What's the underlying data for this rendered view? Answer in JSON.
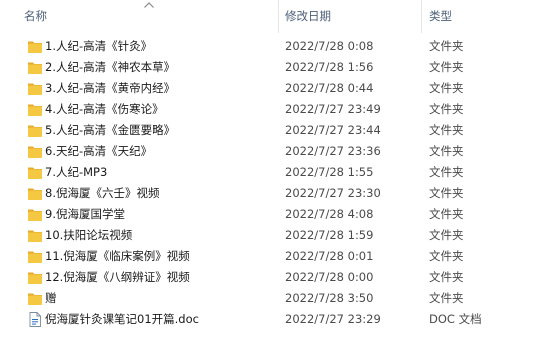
{
  "columns": {
    "name": "名称",
    "date": "修改日期",
    "type": "类型"
  },
  "sort": {
    "column": "name",
    "direction": "ascending",
    "icon": "chevron-up-icon"
  },
  "files": [
    {
      "name": "1.人纪-高清《针灸》",
      "date": "2022/7/28 0:08",
      "type": "文件夹",
      "icon": "folder-icon"
    },
    {
      "name": "2.人纪-高清《神农本草》",
      "date": "2022/7/28 1:56",
      "type": "文件夹",
      "icon": "folder-icon"
    },
    {
      "name": "3.人纪-高清《黄帝内经》",
      "date": "2022/7/28 0:44",
      "type": "文件夹",
      "icon": "folder-icon"
    },
    {
      "name": "4.人纪-高清《伤寒论》",
      "date": "2022/7/27 23:49",
      "type": "文件夹",
      "icon": "folder-icon"
    },
    {
      "name": "5.人纪-高清《金匮要略》",
      "date": "2022/7/27 23:44",
      "type": "文件夹",
      "icon": "folder-icon"
    },
    {
      "name": "6.天纪-高清《天纪》",
      "date": "2022/7/27 23:36",
      "type": "文件夹",
      "icon": "folder-icon"
    },
    {
      "name": "7.人纪-MP3",
      "date": "2022/7/28 1:55",
      "type": "文件夹",
      "icon": "folder-icon"
    },
    {
      "name": "8.倪海厦《六壬》视频",
      "date": "2022/7/27 23:30",
      "type": "文件夹",
      "icon": "folder-icon"
    },
    {
      "name": "9.倪海厦国学堂",
      "date": "2022/7/28 4:08",
      "type": "文件夹",
      "icon": "folder-icon"
    },
    {
      "name": "10.扶阳论坛视频",
      "date": "2022/7/28 1:59",
      "type": "文件夹",
      "icon": "folder-icon"
    },
    {
      "name": "11.倪海厦《临床案例》视频",
      "date": "2022/7/28 0:01",
      "type": "文件夹",
      "icon": "folder-icon"
    },
    {
      "name": "12.倪海厦《八纲辨证》视频",
      "date": "2022/7/28 0:00",
      "type": "文件夹",
      "icon": "folder-icon"
    },
    {
      "name": "赠",
      "date": "2022/7/28 3:50",
      "type": "文件夹",
      "icon": "folder-icon"
    },
    {
      "name": "倪海厦针灸课笔记01开篇.doc",
      "date": "2022/7/27 23:29",
      "type": "DOC 文档",
      "icon": "document-icon"
    }
  ],
  "colors": {
    "header_text": "#4c607a",
    "folder_body": "#f5c843",
    "folder_tab": "#e8aa2b",
    "doc_accent": "#2b6cc4"
  }
}
